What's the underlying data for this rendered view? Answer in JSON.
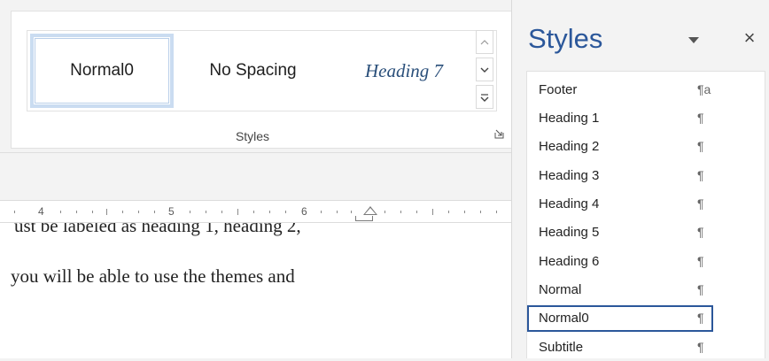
{
  "ribbon": {
    "gallery": {
      "items": [
        "Normal0",
        "No Spacing",
        "Heading 7"
      ],
      "scroll_up_icon": "chevron-up-icon",
      "scroll_down_icon": "chevron-down-icon",
      "more_icon": "more-styles-icon"
    },
    "group_label": "Styles",
    "dialog_launcher_icon": "dialog-launcher-icon"
  },
  "ruler": {
    "numbers": [
      "4",
      "5",
      "6"
    ]
  },
  "document": {
    "line1": "ust be labeled as heading 1, heading 2,",
    "line2": "you will be able to use the themes and"
  },
  "styles_pane": {
    "title": "Styles",
    "close_glyph": "×",
    "items": [
      {
        "name": "Footer",
        "mark": "¶a"
      },
      {
        "name": "Heading 1",
        "mark": "¶"
      },
      {
        "name": "Heading 2",
        "mark": "¶"
      },
      {
        "name": "Heading 3",
        "mark": "¶"
      },
      {
        "name": "Heading 4",
        "mark": "¶"
      },
      {
        "name": "Heading 5",
        "mark": "¶"
      },
      {
        "name": "Heading 6",
        "mark": "¶"
      },
      {
        "name": "Normal",
        "mark": "¶"
      },
      {
        "name": "Normal0",
        "mark": "¶"
      },
      {
        "name": "Subtitle",
        "mark": "¶"
      }
    ],
    "selected": "Normal0"
  },
  "colors": {
    "accent": "#2b579a",
    "selection_border": "#cadcf1",
    "heading7_text": "#2a4f7a"
  }
}
